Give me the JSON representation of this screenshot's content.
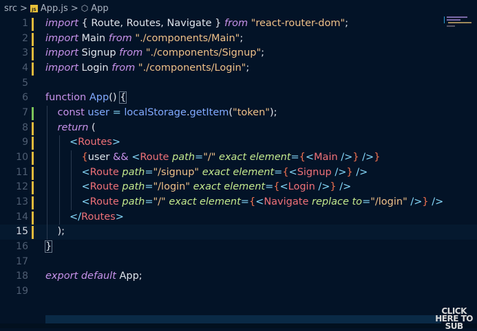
{
  "breadcrumb": {
    "folder": "src",
    "file": "App.js",
    "file_icon_label": "JS",
    "symbol": "App",
    "separator": ">",
    "symbol_icon": "cube-icon"
  },
  "editor": {
    "active_line": 15,
    "lines": [
      {
        "n": "1",
        "gutter": "modified",
        "indent": 0,
        "tokens": [
          [
            "kw",
            "import"
          ],
          [
            "txt",
            " { Route, Routes, Navigate } "
          ],
          [
            "kw",
            "from"
          ],
          [
            "txt",
            " "
          ],
          [
            "str",
            "\"react-router-dom\""
          ],
          [
            "txt",
            ";"
          ]
        ]
      },
      {
        "n": "2",
        "gutter": "modified",
        "indent": 0,
        "tokens": [
          [
            "kw",
            "import"
          ],
          [
            "txt",
            " Main "
          ],
          [
            "kw",
            "from"
          ],
          [
            "txt",
            " "
          ],
          [
            "str",
            "\"./components/Main\""
          ],
          [
            "txt",
            ";"
          ]
        ]
      },
      {
        "n": "3",
        "gutter": "modified",
        "indent": 0,
        "tokens": [
          [
            "kw",
            "import"
          ],
          [
            "txt",
            " Signup "
          ],
          [
            "kw",
            "from"
          ],
          [
            "txt",
            " "
          ],
          [
            "str",
            "\"./components/Signup\""
          ],
          [
            "txt",
            ";"
          ]
        ]
      },
      {
        "n": "4",
        "gutter": "modified",
        "indent": 0,
        "tokens": [
          [
            "kw",
            "import"
          ],
          [
            "txt",
            " Login "
          ],
          [
            "kw",
            "from"
          ],
          [
            "txt",
            " "
          ],
          [
            "str",
            "\"./components/Login\""
          ],
          [
            "txt",
            ";"
          ]
        ]
      },
      {
        "n": "5",
        "gutter": "",
        "indent": 0,
        "tokens": []
      },
      {
        "n": "6",
        "gutter": "",
        "indent": 0,
        "tokens": [
          [
            "kwn",
            "function"
          ],
          [
            "txt",
            " "
          ],
          [
            "fn",
            "App"
          ],
          [
            "txt",
            "() "
          ],
          [
            "box",
            "{"
          ]
        ]
      },
      {
        "n": "7",
        "gutter": "added",
        "indent": 1,
        "tokens": [
          [
            "kwn",
            "const"
          ],
          [
            "txt",
            " "
          ],
          [
            "var",
            "user"
          ],
          [
            "txt",
            " "
          ],
          [
            "pun",
            "="
          ],
          [
            "txt",
            " "
          ],
          [
            "fn",
            "localStorage"
          ],
          [
            "txt",
            "."
          ],
          [
            "fn",
            "getItem"
          ],
          [
            "txt",
            "("
          ],
          [
            "str",
            "\"token\""
          ],
          [
            "txt",
            ");"
          ]
        ]
      },
      {
        "n": "8",
        "gutter": "modified",
        "indent": 1,
        "tokens": [
          [
            "kw",
            "return"
          ],
          [
            "txt",
            " ("
          ]
        ]
      },
      {
        "n": "9",
        "gutter": "modified",
        "indent": 2,
        "tokens": [
          [
            "pun",
            "<"
          ],
          [
            "tag",
            "Routes"
          ],
          [
            "pun",
            ">"
          ]
        ]
      },
      {
        "n": "10",
        "gutter": "modified",
        "indent": 3,
        "tokens": [
          [
            "brk",
            "{"
          ],
          [
            "txt",
            "user "
          ],
          [
            "kwn",
            "&&"
          ],
          [
            "txt",
            " "
          ],
          [
            "pun",
            "<"
          ],
          [
            "tag",
            "Route"
          ],
          [
            "txt",
            " "
          ],
          [
            "attr",
            "path"
          ],
          [
            "pun",
            "="
          ],
          [
            "str",
            "\"/\""
          ],
          [
            "txt",
            " "
          ],
          [
            "attr",
            "exact"
          ],
          [
            "txt",
            " "
          ],
          [
            "attr",
            "element"
          ],
          [
            "pun",
            "="
          ],
          [
            "brk",
            "{"
          ],
          [
            "pun",
            "<"
          ],
          [
            "tag",
            "Main"
          ],
          [
            "txt",
            " "
          ],
          [
            "pun",
            "/>"
          ],
          [
            "brk",
            "}"
          ],
          [
            "txt",
            " "
          ],
          [
            "pun",
            "/>"
          ],
          [
            "brk",
            "}"
          ]
        ]
      },
      {
        "n": "11",
        "gutter": "modified",
        "indent": 3,
        "tokens": [
          [
            "pun",
            "<"
          ],
          [
            "tag",
            "Route"
          ],
          [
            "txt",
            " "
          ],
          [
            "attr",
            "path"
          ],
          [
            "pun",
            "="
          ],
          [
            "str",
            "\"/signup\""
          ],
          [
            "txt",
            " "
          ],
          [
            "attr",
            "exact"
          ],
          [
            "txt",
            " "
          ],
          [
            "attr",
            "element"
          ],
          [
            "pun",
            "="
          ],
          [
            "brk",
            "{"
          ],
          [
            "pun",
            "<"
          ],
          [
            "tag",
            "Signup"
          ],
          [
            "txt",
            " "
          ],
          [
            "pun",
            "/>"
          ],
          [
            "brk",
            "}"
          ],
          [
            "txt",
            " "
          ],
          [
            "pun",
            "/>"
          ]
        ]
      },
      {
        "n": "12",
        "gutter": "modified",
        "indent": 3,
        "tokens": [
          [
            "pun",
            "<"
          ],
          [
            "tag",
            "Route"
          ],
          [
            "txt",
            " "
          ],
          [
            "attr",
            "path"
          ],
          [
            "pun",
            "="
          ],
          [
            "str",
            "\"/login\""
          ],
          [
            "txt",
            " "
          ],
          [
            "attr",
            "exact"
          ],
          [
            "txt",
            " "
          ],
          [
            "attr",
            "element"
          ],
          [
            "pun",
            "="
          ],
          [
            "brk",
            "{"
          ],
          [
            "pun",
            "<"
          ],
          [
            "tag",
            "Login"
          ],
          [
            "txt",
            " "
          ],
          [
            "pun",
            "/>"
          ],
          [
            "brk",
            "}"
          ],
          [
            "txt",
            " "
          ],
          [
            "pun",
            "/>"
          ]
        ]
      },
      {
        "n": "13",
        "gutter": "modified",
        "indent": 3,
        "tokens": [
          [
            "pun",
            "<"
          ],
          [
            "tag",
            "Route"
          ],
          [
            "txt",
            " "
          ],
          [
            "attr",
            "path"
          ],
          [
            "pun",
            "="
          ],
          [
            "str",
            "\"/\""
          ],
          [
            "txt",
            " "
          ],
          [
            "attr",
            "exact"
          ],
          [
            "txt",
            " "
          ],
          [
            "attr",
            "element"
          ],
          [
            "pun",
            "="
          ],
          [
            "brk",
            "{"
          ],
          [
            "pun",
            "<"
          ],
          [
            "tag",
            "Navigate"
          ],
          [
            "txt",
            " "
          ],
          [
            "attr",
            "replace"
          ],
          [
            "txt",
            " "
          ],
          [
            "attr",
            "to"
          ],
          [
            "pun",
            "="
          ],
          [
            "str",
            "\"/login\""
          ],
          [
            "txt",
            " "
          ],
          [
            "pun",
            "/>"
          ],
          [
            "brk",
            "}"
          ],
          [
            "txt",
            " "
          ],
          [
            "pun",
            "/>"
          ]
        ]
      },
      {
        "n": "14",
        "gutter": "modified",
        "indent": 2,
        "tokens": [
          [
            "pun",
            "</"
          ],
          [
            "tag",
            "Routes"
          ],
          [
            "pun",
            ">"
          ]
        ]
      },
      {
        "n": "15",
        "gutter": "modified",
        "indent": 1,
        "tokens": [
          [
            "txt",
            ");"
          ]
        ]
      },
      {
        "n": "16",
        "gutter": "",
        "indent": 0,
        "tokens": [
          [
            "box",
            "}"
          ]
        ]
      },
      {
        "n": "17",
        "gutter": "",
        "indent": 0,
        "tokens": []
      },
      {
        "n": "18",
        "gutter": "",
        "indent": 0,
        "tokens": [
          [
            "kw",
            "export"
          ],
          [
            "txt",
            " "
          ],
          [
            "kw",
            "default"
          ],
          [
            "txt",
            " App;"
          ]
        ]
      },
      {
        "n": "19",
        "gutter": "",
        "indent": 0,
        "tokens": []
      }
    ]
  },
  "colors": {
    "background": "#031327",
    "modified": "#e2b93b",
    "added": "#7bc35a",
    "scrollbar": "#0a2a46"
  },
  "watermark": {
    "line1": "CLICK",
    "line2": "HERE TO",
    "line3": "SUB"
  }
}
